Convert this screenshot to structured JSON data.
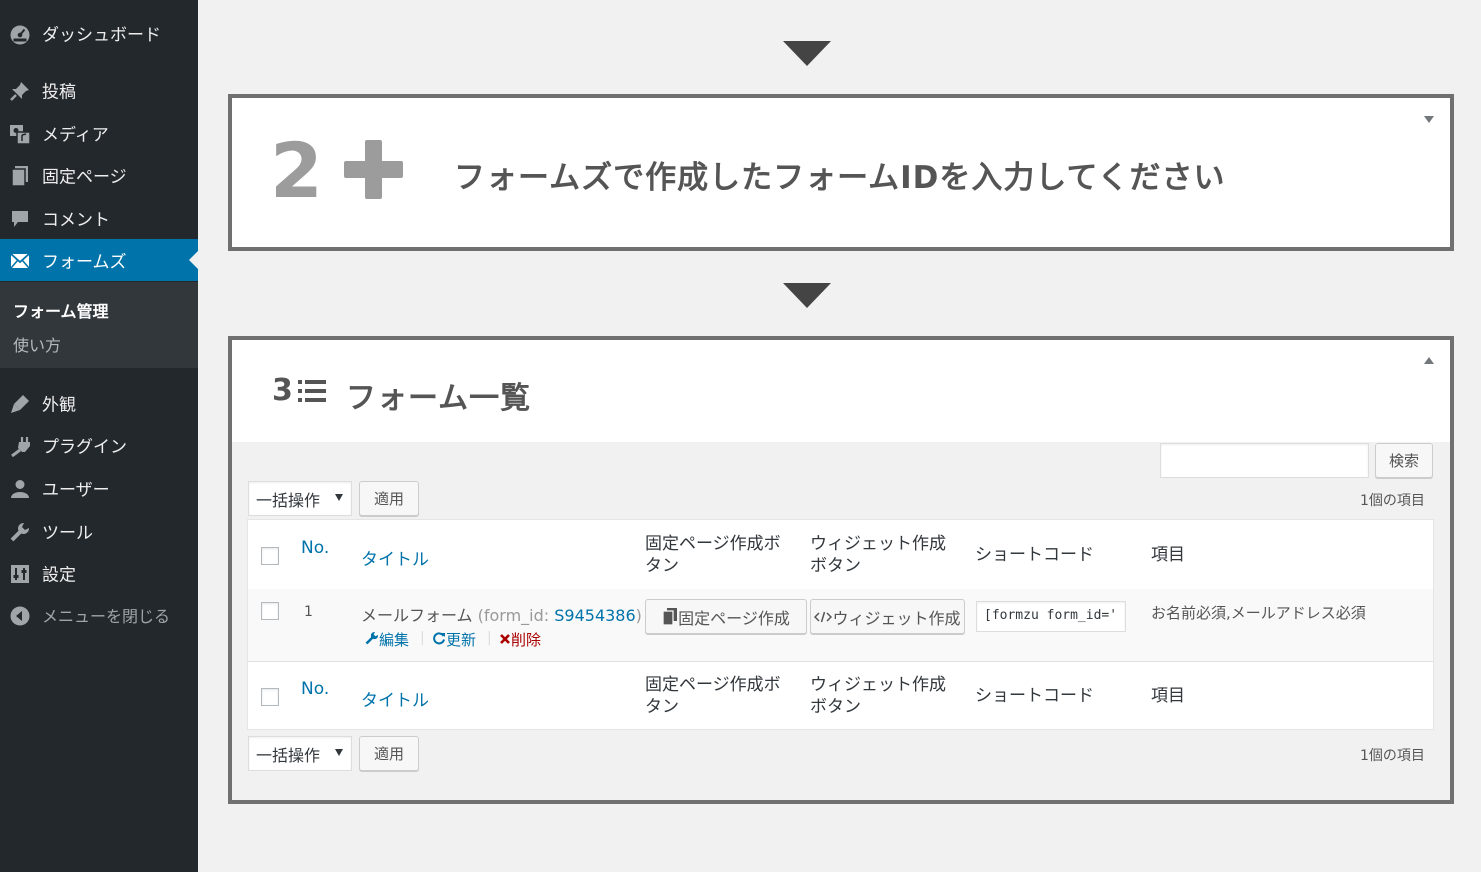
{
  "sidebar": {
    "items": [
      {
        "label": "ダッシュボード",
        "icon": "dashboard-icon"
      },
      {
        "label": "投稿",
        "icon": "pushpin-icon"
      },
      {
        "label": "メディア",
        "icon": "media-icon"
      },
      {
        "label": "固定ページ",
        "icon": "page-icon"
      },
      {
        "label": "コメント",
        "icon": "comment-icon"
      },
      {
        "label": "フォームズ",
        "icon": "mail-icon"
      },
      {
        "label": "外観",
        "icon": "appearance-icon"
      },
      {
        "label": "プラグイン",
        "icon": "plugin-icon"
      },
      {
        "label": "ユーザー",
        "icon": "user-icon"
      },
      {
        "label": "ツール",
        "icon": "wrench-icon"
      },
      {
        "label": "設定",
        "icon": "settings-icon"
      },
      {
        "label": "メニューを閉じる",
        "icon": "collapse-icon"
      }
    ],
    "submenu": [
      {
        "label": "フォーム管理"
      },
      {
        "label": "使い方"
      }
    ],
    "active_color": "#0073aa"
  },
  "step2": {
    "number": "2",
    "title": "フォームズで作成したフォームIDを入力してください"
  },
  "step3": {
    "number": "3",
    "title": "フォーム一覧"
  },
  "search": {
    "button": "検索",
    "value": ""
  },
  "bulk": {
    "select": "一括操作",
    "apply": "適用"
  },
  "count": "1個の項目",
  "table": {
    "headers": {
      "no": "No.",
      "title": "タイトル",
      "page_btn": "固定ページ作成ボタン",
      "widget_btn": "ウィジェット作成ボタン",
      "shortcode": "ショートコード",
      "fields": "項目"
    },
    "rows": [
      {
        "no": "1",
        "title": "メールフォーム",
        "form_id_prefix": "(form_id: ",
        "form_id": "S9454386",
        "form_id_suffix": ")",
        "actions": {
          "edit": "編集",
          "update": "更新",
          "delete": "削除"
        },
        "page_button": "固定ページ作成",
        "widget_button": "ウィジェット作成",
        "shortcode": "[formzu form_id='",
        "fields": "お名前必須,メールアドレス必須"
      }
    ]
  }
}
